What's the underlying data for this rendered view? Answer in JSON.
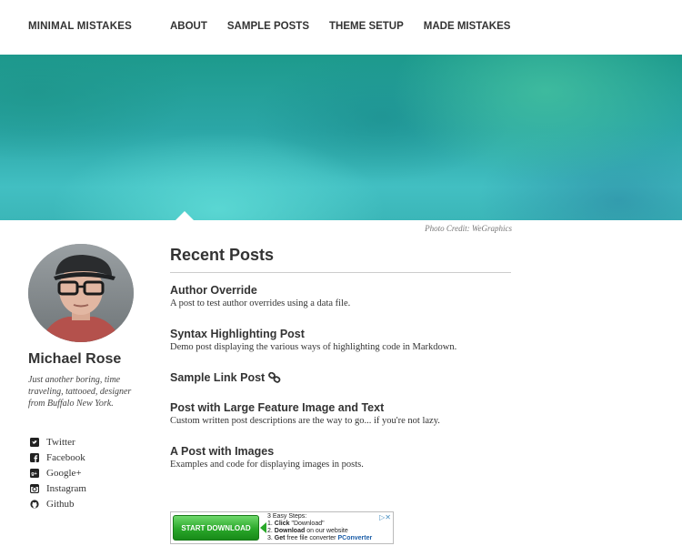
{
  "nav": {
    "brand": "MINIMAL MISTAKES",
    "links": [
      "ABOUT",
      "SAMPLE POSTS",
      "THEME SETUP",
      "MADE MISTAKES"
    ]
  },
  "hero": {
    "photo_credit": "Photo Credit: WeGraphics"
  },
  "author": {
    "name": "Michael Rose",
    "bio": "Just another boring, time traveling, tattooed, designer from Buffalo New York.",
    "social": [
      {
        "label": "Twitter",
        "icon": "twitter-icon"
      },
      {
        "label": "Facebook",
        "icon": "facebook-icon"
      },
      {
        "label": "Google+",
        "icon": "google-plus-icon"
      },
      {
        "label": "Instagram",
        "icon": "instagram-icon"
      },
      {
        "label": "Github",
        "icon": "github-icon"
      }
    ]
  },
  "main": {
    "heading": "Recent Posts",
    "posts": [
      {
        "title": "Author Override",
        "excerpt": "A post to test author overrides using a data file."
      },
      {
        "title": "Syntax Highlighting Post",
        "excerpt": "Demo post displaying the various ways of highlighting code in Markdown."
      },
      {
        "title": "Sample Link Post",
        "excerpt": "",
        "icon": "link-icon"
      },
      {
        "title": "Post with Large Feature Image and Text",
        "excerpt": "Custom written post descriptions are the way to go... if you're not lazy."
      },
      {
        "title": "A Post with Images",
        "excerpt": "Examples and code for displaying images in posts."
      }
    ]
  },
  "ad": {
    "button": "START DOWNLOAD",
    "line1": "3 Easy Steps:",
    "line2_num": "1.",
    "line2_bold": "Click",
    "line2_rest": "\"Download\"",
    "line3_num": "2.",
    "line3_bold": "Download",
    "line3_rest": "on our website",
    "line4_num": "3.",
    "line4_bold": "Get",
    "line4_rest": "free file converter",
    "brand": "PConverter",
    "close": "▷✕"
  },
  "colors": {
    "hero_primary": "#2ba6a6",
    "hero_light": "#42bfc2",
    "hero_dark": "#1d9a8c",
    "ad_green": "#2aa82a"
  }
}
